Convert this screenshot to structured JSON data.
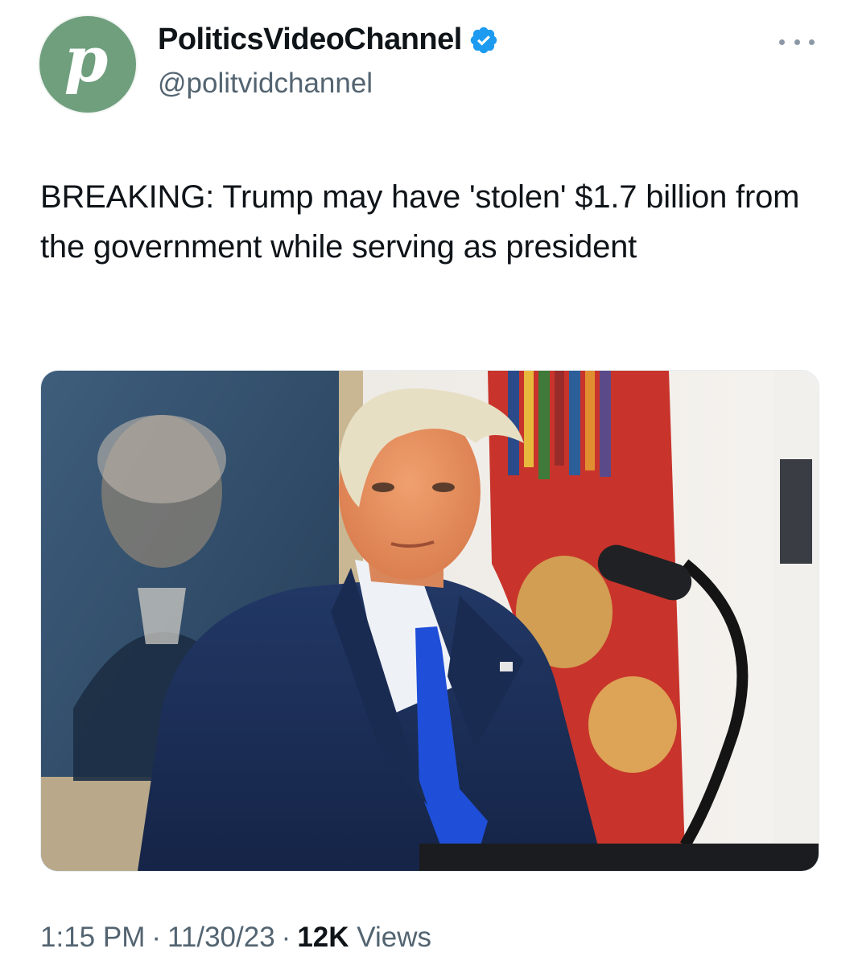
{
  "author": {
    "display_name": "PoliticsVideoChannel",
    "handle": "@politvidchannel",
    "avatar_letter": "p",
    "verified_icon": "verified-badge-icon",
    "avatar_color": "#6f9f7d"
  },
  "tweet": {
    "text": "BREAKING: Trump may have 'stolen' $1.7 billion from the government while serving as president"
  },
  "meta": {
    "time": "1:15 PM",
    "separator": "·",
    "date": "11/30/23",
    "views_count": "12K",
    "views_label": "Views"
  },
  "colors": {
    "verified_blue": "#1d9bf0",
    "secondary_text": "#536471",
    "primary_text": "#0f1419"
  }
}
